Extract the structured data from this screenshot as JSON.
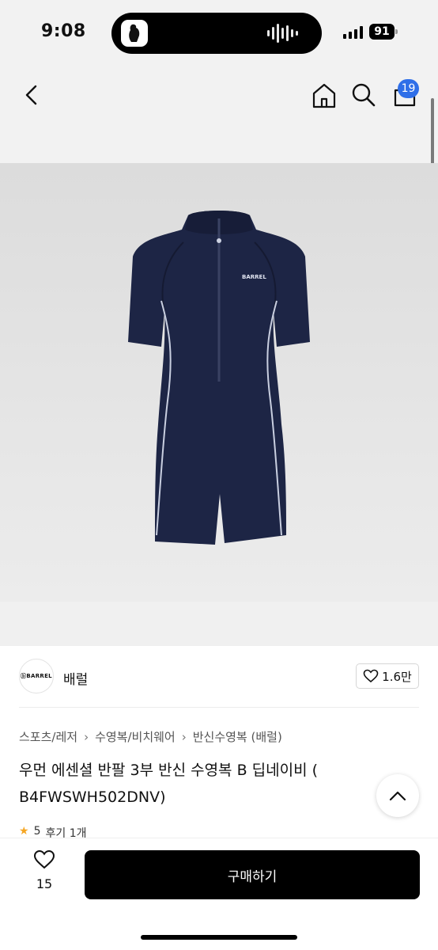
{
  "status_bar": {
    "time": "9:08",
    "battery": "91"
  },
  "nav": {
    "cart_count": "19"
  },
  "product": {
    "image_brand_text": "BARREL",
    "brand": {
      "logo_text": "ⓑBARREL",
      "name": "배럴",
      "likes": "1.6만"
    },
    "breadcrumb": [
      "스포츠/레저",
      "수영복/비치웨어",
      "반신수영복 (배럴)"
    ],
    "title_line1": "우먼 에센셜 반팔 3부 반신 수영복 B 딥네이비 (",
    "title_line2": "B4FWSWH502DNV)",
    "rating_score": "5",
    "rating_reviews": "후기 1개"
  },
  "bottom_bar": {
    "wish_count": "15",
    "buy_label": "구매하기"
  },
  "colors": {
    "accent_badge": "#2f6fe8",
    "swimsuit": "#1d2545",
    "piping": "#c9cfe0",
    "buy_button": "#000000"
  }
}
